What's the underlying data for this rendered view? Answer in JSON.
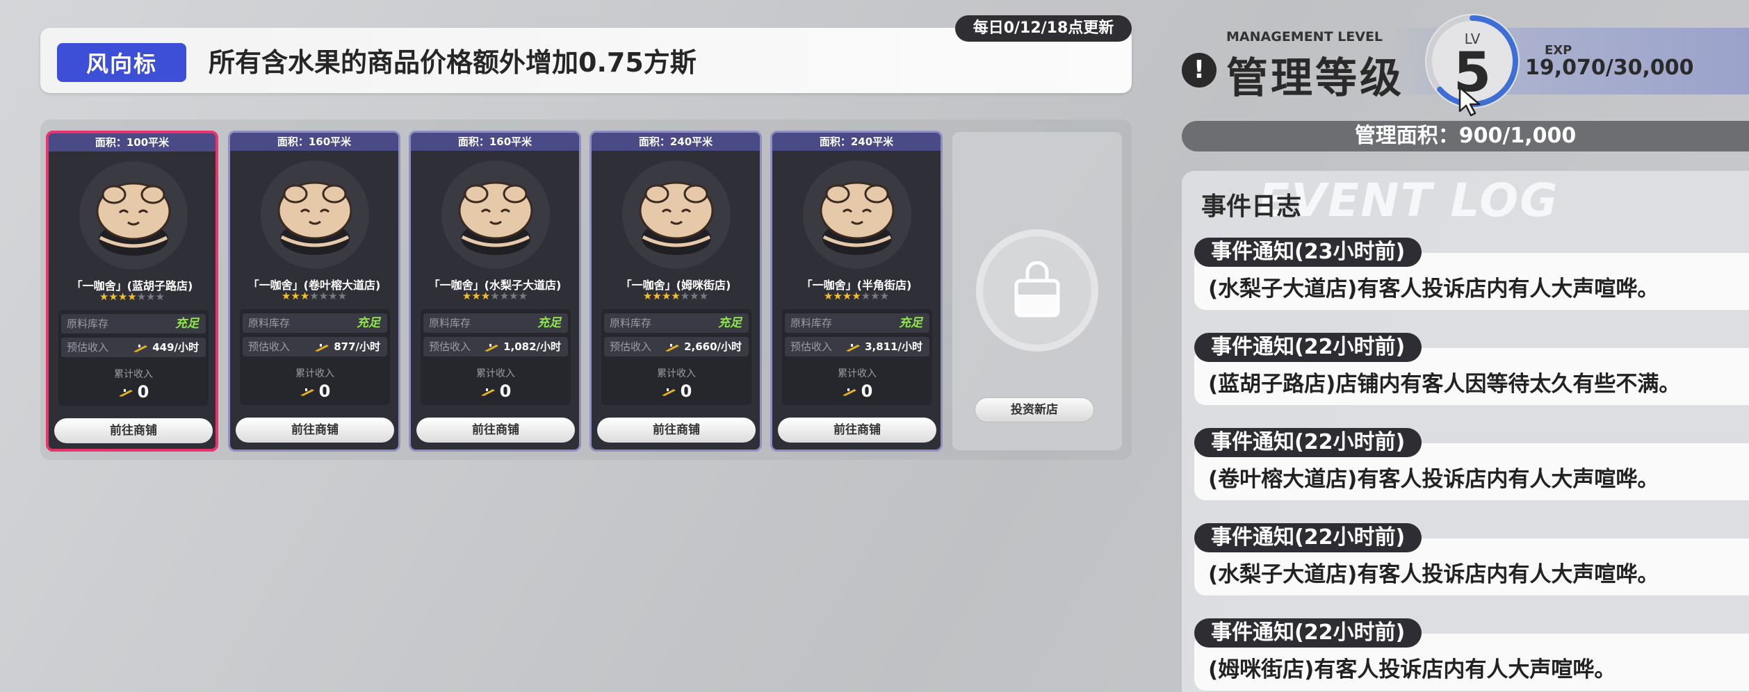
{
  "banner": {
    "tag": "风向标",
    "message": "所有含水果的商品价格额外增加0.75方斯",
    "refresh": "每日0/12/18点更新"
  },
  "shops": [
    {
      "area": "面积：100平米",
      "name": "「一咖舍」(蓝胡子路店)",
      "stars": 4,
      "stock_label": "原料库存",
      "stock_value": "充足",
      "income_label": "预估收入",
      "income_value": "449/小时",
      "accum_label": "累计收入",
      "accum_value": "0",
      "button": "前往商铺",
      "selected": true
    },
    {
      "area": "面积：160平米",
      "name": "「一咖舍」(卷叶榕大道店)",
      "stars": 3,
      "stock_label": "原料库存",
      "stock_value": "充足",
      "income_label": "预估收入",
      "income_value": "877/小时",
      "accum_label": "累计收入",
      "accum_value": "0",
      "button": "前往商铺",
      "selected": false
    },
    {
      "area": "面积：160平米",
      "name": "「一咖舍」(水梨子大道店)",
      "stars": 3,
      "stock_label": "原料库存",
      "stock_value": "充足",
      "income_label": "预估收入",
      "income_value": "1,082/小时",
      "accum_label": "累计收入",
      "accum_value": "0",
      "button": "前往商铺",
      "selected": false
    },
    {
      "area": "面积：240平米",
      "name": "「一咖舍」(姆咪街店)",
      "stars": 4,
      "stock_label": "原料库存",
      "stock_value": "充足",
      "income_label": "预估收入",
      "income_value": "2,660/小时",
      "accum_label": "累计收入",
      "accum_value": "0",
      "button": "前往商铺",
      "selected": false
    },
    {
      "area": "面积：240平米",
      "name": "「一咖舍」(半角街店)",
      "stars": 4,
      "stock_label": "原料库存",
      "stock_value": "充足",
      "income_label": "预估收入",
      "income_value": "3,811/小时",
      "accum_label": "累计收入",
      "accum_value": "0",
      "button": "前往商铺",
      "selected": false
    }
  ],
  "star_max": 7,
  "new_shop": {
    "button": "投资新店",
    "icon": "shopping-bag-icon"
  },
  "level": {
    "title_en": "MANAGEMENT LEVEL",
    "title_cn": "管理等级",
    "lv_label": "LV",
    "lv_value": "5",
    "exp_label": "EXP",
    "exp_value": "19,070/30,000",
    "exp_progress": 0.636
  },
  "area": {
    "text": "管理面积：900/1,000"
  },
  "log": {
    "title": "事件日志",
    "watermark": "EVENT LOG",
    "events": [
      {
        "head": "事件通知(23小时前)",
        "body": "(水梨子大道店)有客人投诉店内有人大声喧哗。"
      },
      {
        "head": "事件通知(22小时前)",
        "body": "(蓝胡子路店)店铺内有客人因等待太久有些不满。"
      },
      {
        "head": "事件通知(22小时前)",
        "body": "(卷叶榕大道店)有客人投诉店内有人大声喧哗。"
      },
      {
        "head": "事件通知(22小时前)",
        "body": "(水梨子大道店)有客人投诉店内有人大声喧哗。"
      },
      {
        "head": "事件通知(22小时前)",
        "body": "(姆咪街店)有客人投诉店内有人大声喧哗。"
      }
    ]
  },
  "colors": {
    "accent": "#3d4fd6",
    "selected": "#e8336c",
    "stock_ok": "#8fe84a",
    "star": "#f5c02b",
    "lv_ring": "#3d6fd6"
  }
}
